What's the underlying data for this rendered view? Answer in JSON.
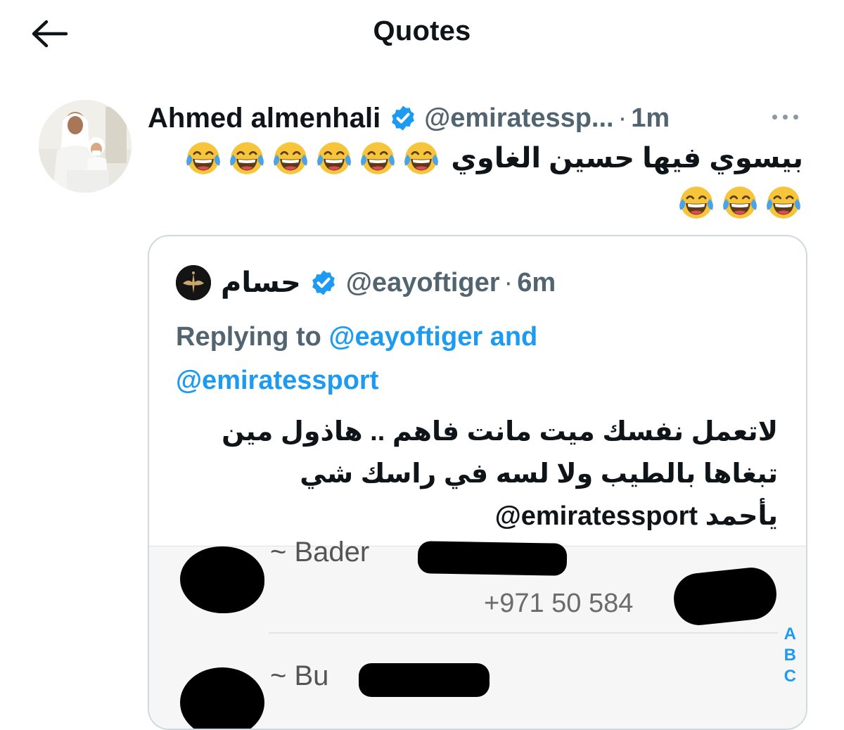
{
  "header": {
    "title": "Quotes",
    "back_icon": "arrow-left-icon"
  },
  "tweet": {
    "author_name": "Ahmed almenhali",
    "author_handle": "@emiratessp...",
    "separator": "·",
    "time": "1m",
    "text": "بيسوي فيها حسين الغاوي",
    "emoji": "😂",
    "emoji_line1_count": 6,
    "emoji_line2_count": 3
  },
  "quote": {
    "author_name": "حسام",
    "author_handle": "@eayoftiger",
    "separator": "·",
    "time": "6m",
    "replying_prefix": "Replying to",
    "replying_user1": "@eayoftiger",
    "replying_and": "and",
    "replying_user2": "@emiratessport",
    "text_line1": "لاتعمل نفسك ميت مانت فاهم .. هاذول مين",
    "text_line2": "تبغاها بالطيب ولا لسه في راسك شي",
    "text_line3_mention": "@emiratessport",
    "text_line3_word": "يأحمد",
    "image": {
      "contact1_name": "~ Bader",
      "contact1_phone": "+971 50 584",
      "contact2_name": "~ Bu",
      "alpha_index": [
        "A",
        "B",
        "C"
      ]
    }
  },
  "colors": {
    "accent": "#1d9bf0",
    "secondary_text": "#536471",
    "border": "#cfd9de"
  }
}
